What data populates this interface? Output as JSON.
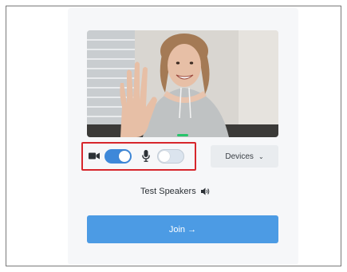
{
  "preview": {
    "camera_enabled": true,
    "microphone_enabled": false
  },
  "controls": {
    "devices_label": "Devices",
    "devices_chevron": "⌄"
  },
  "test_speakers": {
    "label": "Test Speakers"
  },
  "join": {
    "label": "Join →"
  },
  "colors": {
    "accent": "#3e88d9",
    "join_button": "#4c9be4",
    "highlight_border": "#d7262c",
    "live_indicator": "#27c46b"
  },
  "icons": [
    "video-camera-icon",
    "microphone-icon",
    "chevron-down-icon",
    "speaker-icon"
  ]
}
